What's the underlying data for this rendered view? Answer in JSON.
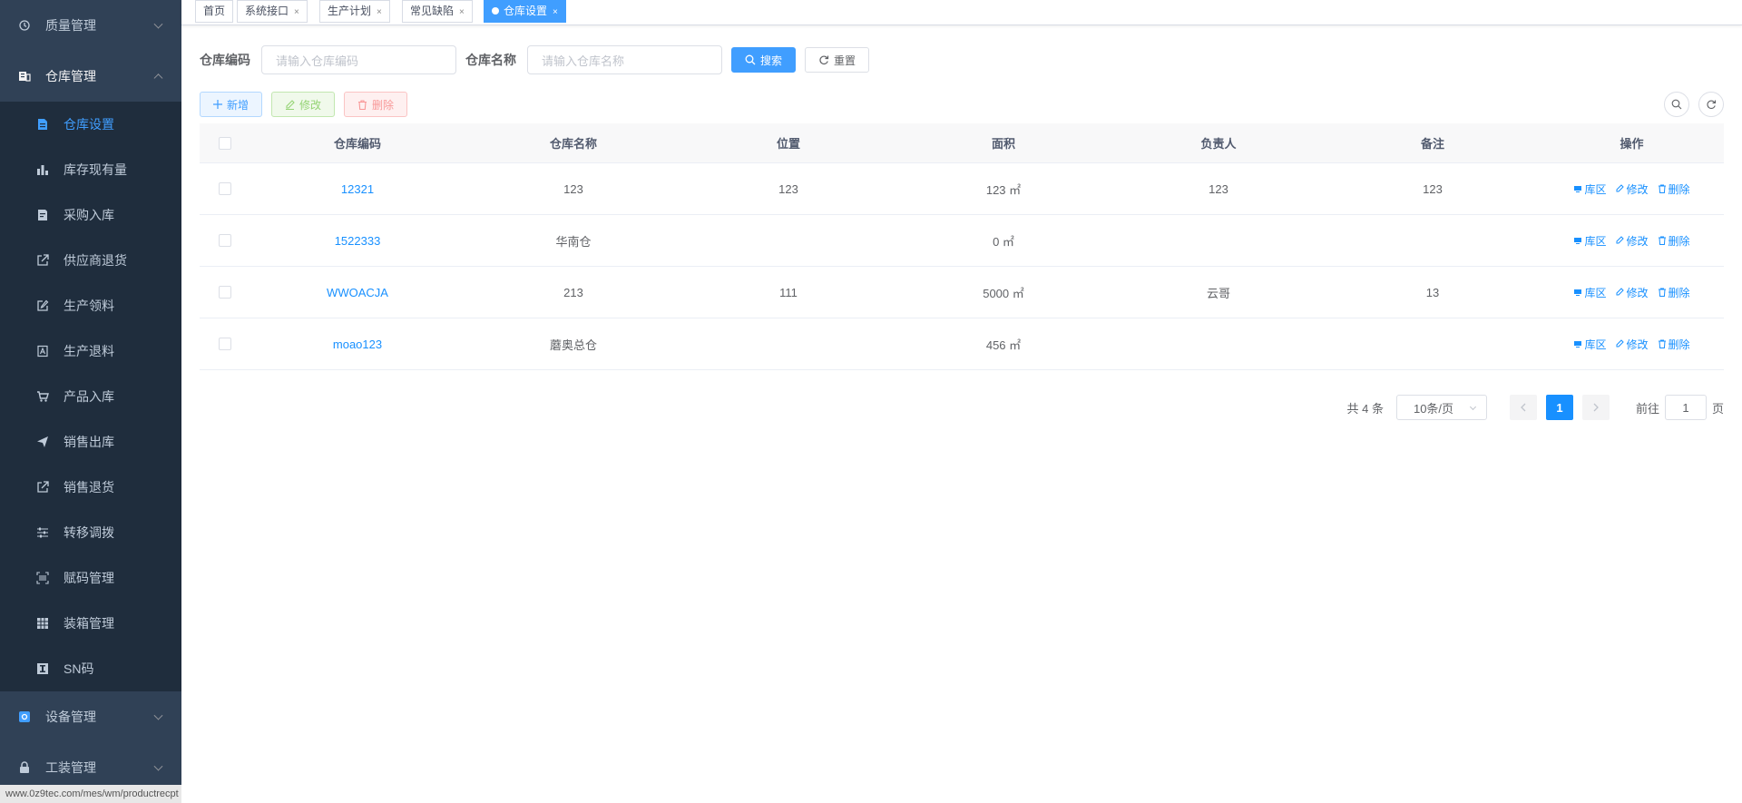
{
  "sidebar": {
    "groups": [
      {
        "label": "质量管理",
        "icon": "quality-icon"
      },
      {
        "label": "仓库管理",
        "icon": "warehouse-icon"
      }
    ],
    "items": [
      {
        "label": "仓库设置",
        "icon": "document-icon"
      },
      {
        "label": "库存现有量",
        "icon": "bar-chart-icon"
      },
      {
        "label": "采购入库",
        "icon": "form-icon"
      },
      {
        "label": "供应商退货",
        "icon": "external-link-icon"
      },
      {
        "label": "生产领料",
        "icon": "edit-icon"
      },
      {
        "label": "生产退料",
        "icon": "return-icon"
      },
      {
        "label": "产品入库",
        "icon": "cart-icon"
      },
      {
        "label": "销售出库",
        "icon": "send-icon"
      },
      {
        "label": "销售退货",
        "icon": "external-link-icon"
      },
      {
        "label": "转移调拨",
        "icon": "sliders-icon"
      },
      {
        "label": "赋码管理",
        "icon": "barcode-icon"
      },
      {
        "label": "装箱管理",
        "icon": "grid-icon"
      },
      {
        "label": "SN码",
        "icon": "sn-icon"
      }
    ],
    "bottom_groups": [
      {
        "label": "设备管理",
        "icon": "device-icon"
      },
      {
        "label": "工装管理",
        "icon": "lock-icon"
      }
    ],
    "status_url": "www.0z9tec.com/mes/wm/productrecpt"
  },
  "tags": [
    {
      "label": "首页"
    },
    {
      "label": "系统接口",
      "close": "×"
    },
    {
      "label": "生产计划",
      "close": "×"
    },
    {
      "label": "常见缺陷",
      "close": "×"
    },
    {
      "label": "仓库设置",
      "close": "×"
    }
  ],
  "search": {
    "code_label": "仓库编码",
    "code_placeholder": "请输入仓库编码",
    "name_label": "仓库名称",
    "name_placeholder": "请输入仓库名称",
    "search_btn": "搜索",
    "reset_btn": "重置"
  },
  "toolbar": {
    "add": "新增",
    "edit": "修改",
    "delete": "删除"
  },
  "table": {
    "headers": [
      "仓库编码",
      "仓库名称",
      "位置",
      "面积",
      "负责人",
      "备注",
      "操作"
    ],
    "op_labels": {
      "area": "库区",
      "edit": "修改",
      "delete": "删除"
    },
    "rows": [
      {
        "code": "12321",
        "name": "123",
        "location": "123",
        "area": "123 ㎡",
        "owner": "123",
        "remark": "123"
      },
      {
        "code": "1522333",
        "name": "华南仓",
        "location": "",
        "area": "0 ㎡",
        "owner": "",
        "remark": ""
      },
      {
        "code": "WWOACJA",
        "name": "213",
        "location": "111",
        "area": "5000 ㎡",
        "owner": "云哥",
        "remark": "13"
      },
      {
        "code": "moao123",
        "name": "蘑奥总仓",
        "location": "",
        "area": "456 ㎡",
        "owner": "",
        "remark": ""
      }
    ]
  },
  "pagination": {
    "total": "共 4 条",
    "page_size": "10条/页",
    "current": "1",
    "goto_label": "前往",
    "goto_value": "1",
    "page_suffix": "页"
  },
  "colors": {
    "sidebar_bg": "#304156",
    "submenu_bg": "#1f2d3d",
    "primary": "#409eff",
    "link": "#1890ff"
  }
}
